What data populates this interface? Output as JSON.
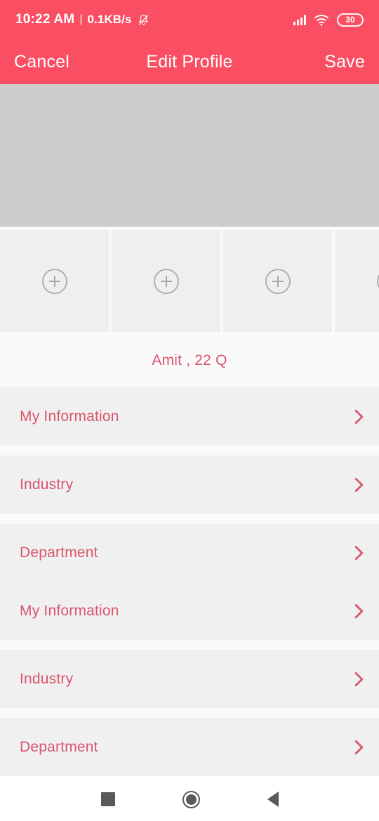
{
  "status_bar": {
    "clock": "10:22 AM",
    "separator": "|",
    "network_speed": "0.1KB/s",
    "mute_icon": "bell-mute-icon",
    "signal_icon": "signal-bars-icon",
    "wifi_icon": "wifi-icon",
    "battery_level": "30"
  },
  "app_bar": {
    "cancel_label": "Cancel",
    "title": "Edit Profile",
    "save_label": "Save"
  },
  "cover": {
    "name": "cover-photo-placeholder",
    "color": "#cccccc"
  },
  "photo_strip": {
    "add_icon": "plus-circle-icon",
    "tiles": [
      {
        "name": "photo-slot-1",
        "state": "empty"
      },
      {
        "name": "photo-slot-2",
        "state": "empty"
      },
      {
        "name": "photo-slot-3",
        "state": "empty"
      },
      {
        "name": "photo-slot-4",
        "state": "empty"
      }
    ]
  },
  "profile": {
    "name_line": "Amit , 22 Q"
  },
  "list": {
    "chevron_icon": "chevron-right-icon",
    "sections": [
      {
        "rows": [
          {
            "label": "My Information"
          }
        ]
      },
      {
        "rows": [
          {
            "label": "Industry"
          }
        ]
      },
      {
        "rows": [
          {
            "label": "Department"
          },
          {
            "label": "My Information"
          }
        ]
      },
      {
        "rows": [
          {
            "label": "Industry"
          }
        ]
      },
      {
        "rows": [
          {
            "label": "Department"
          }
        ]
      }
    ]
  },
  "android_nav": {
    "recents": "recents-square-icon",
    "home": "home-circle-icon",
    "back": "back-triangle-icon"
  },
  "colors": {
    "accent": "#fa4e63",
    "list_text": "#d9556e",
    "row_bg": "#f0f0f0",
    "page_bg": "#fafafa"
  }
}
